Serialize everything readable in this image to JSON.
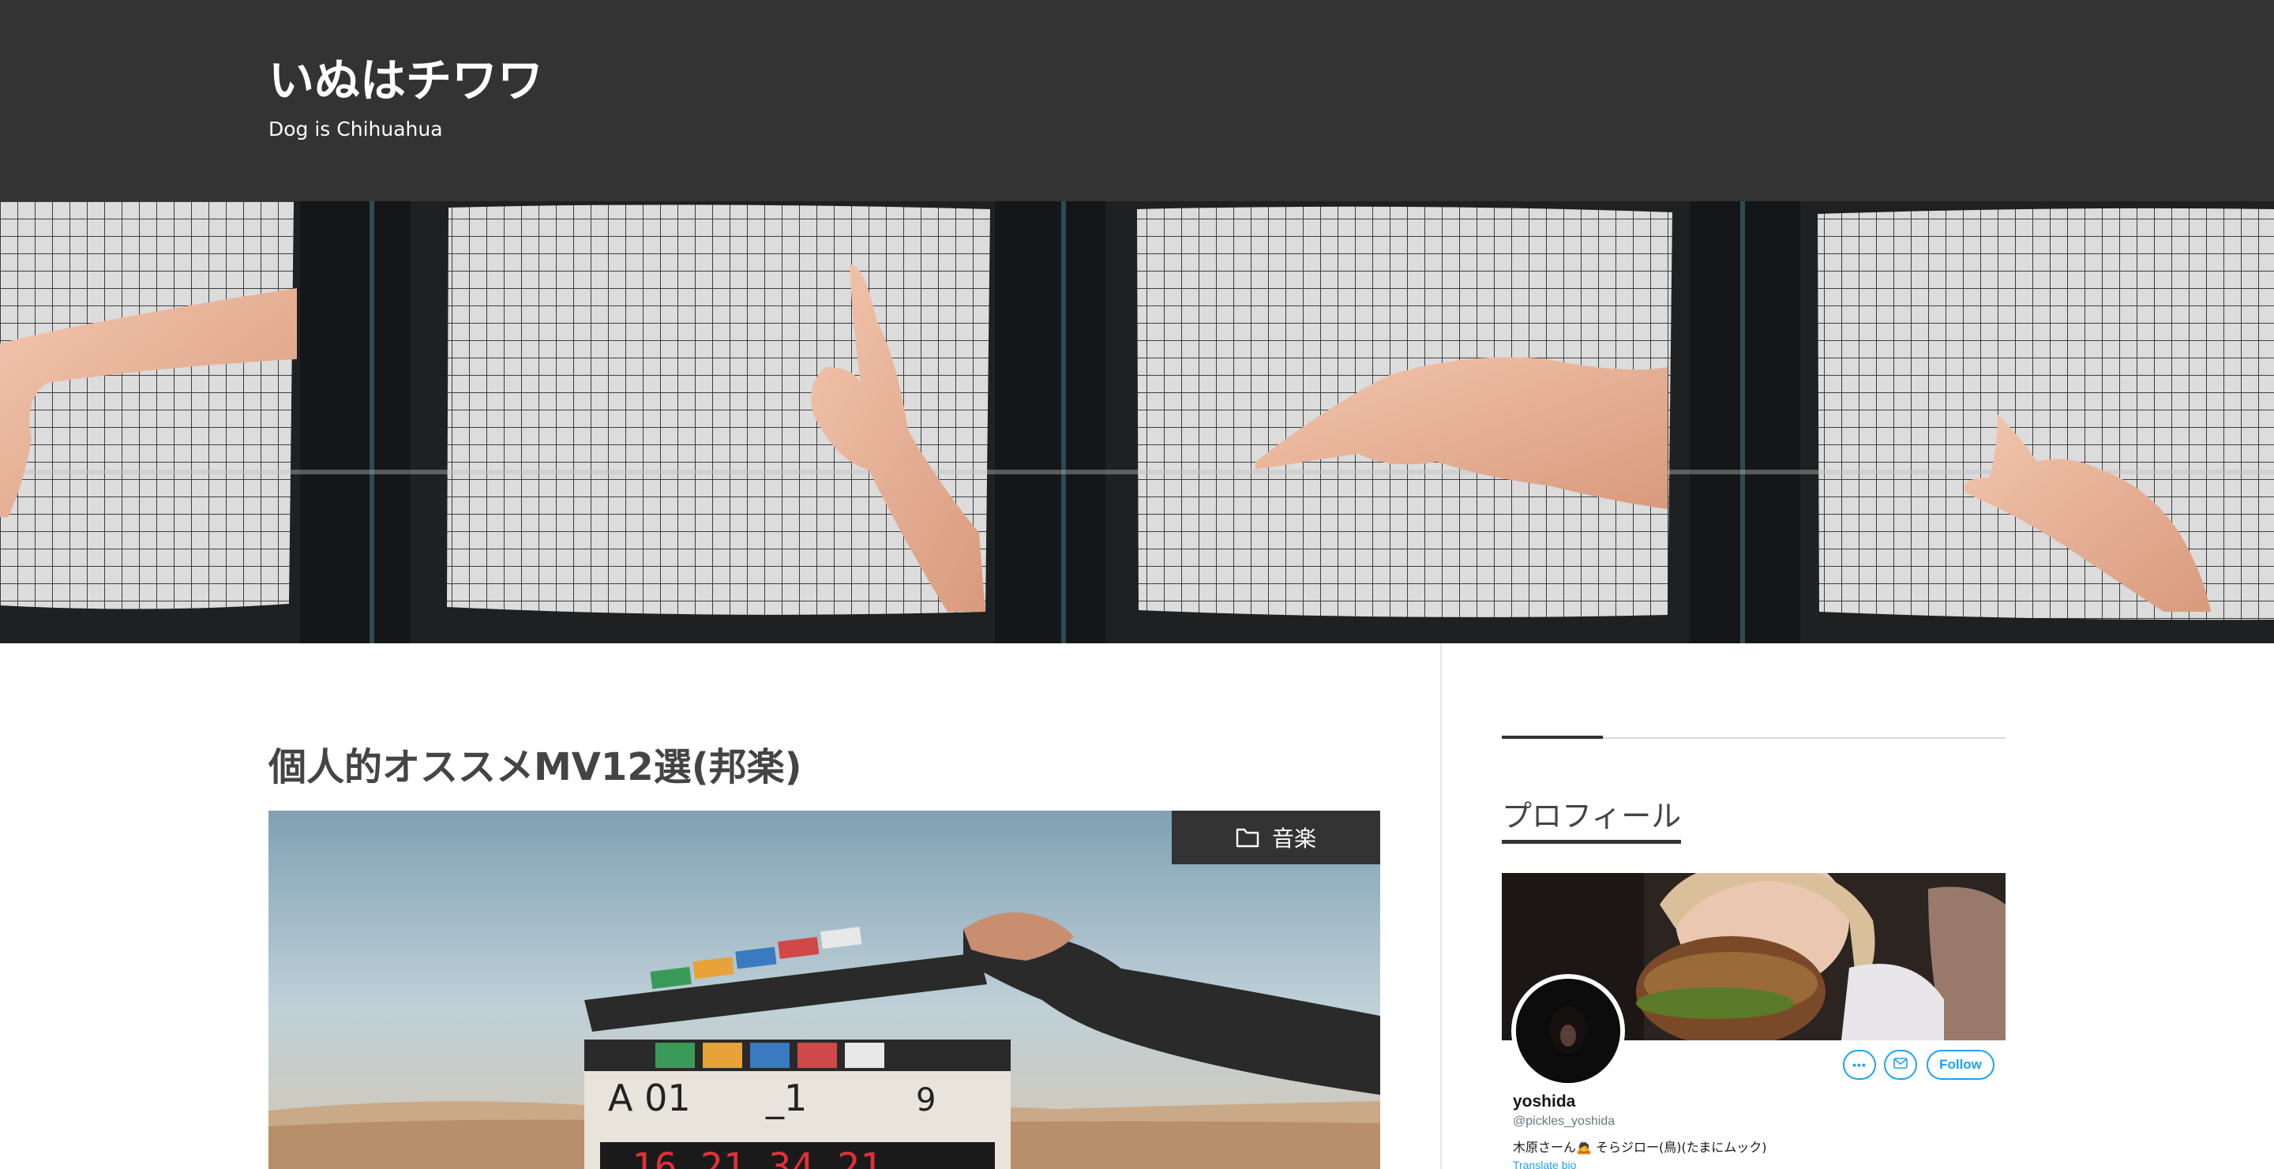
{
  "site": {
    "title": "いぬはチワワ",
    "tagline": "Dog is Chihuahua"
  },
  "hero": {
    "alt": "Four retro TV screens with hands pointing"
  },
  "post": {
    "title": "個人的オススメMV12選(邦楽)",
    "category": "音楽",
    "category_icon": "folder-icon"
  },
  "sidebar": {
    "widget_title": "プロフィール",
    "profile": {
      "name": "yoshida",
      "handle": "@pickles_yoshida",
      "bio": "木原さーん🙇 そらジロー(鳥)(たまにムック)",
      "translate_label": "Translate bio",
      "follow_label": "Follow",
      "more_icon": "more-icon",
      "message_icon": "envelope-icon"
    }
  },
  "colors": {
    "header_bg": "#333333",
    "text_dark": "#444444",
    "twitter_blue": "#1da1f2"
  }
}
